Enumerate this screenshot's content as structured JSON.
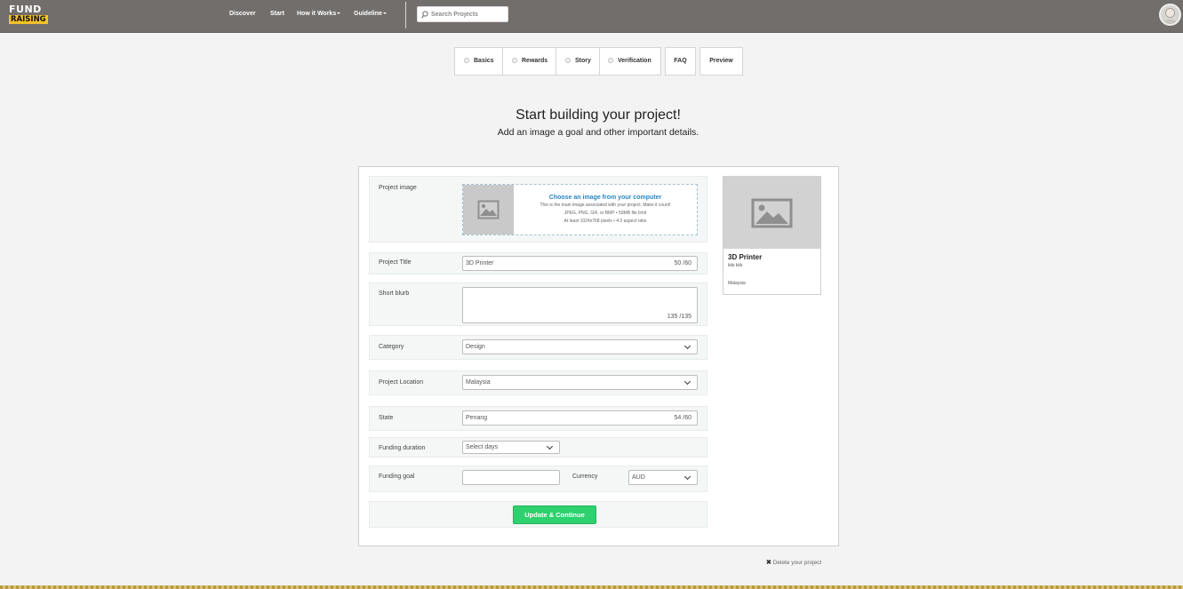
{
  "brand": {
    "line1": "FUND",
    "line2": "RAISING"
  },
  "nav": {
    "discover": "Discover",
    "start": "Start",
    "how_it_works": "How it Works",
    "guideline": "Guideline"
  },
  "search": {
    "placeholder": "Search Projects"
  },
  "tabs": {
    "basics": "Basics",
    "rewards": "Rewards",
    "story": "Story",
    "verification": "Verification",
    "faq": "FAQ",
    "preview": "Preview"
  },
  "heading": {
    "title": "Start building your project!",
    "subtitle": "Add an image a goal and other important details."
  },
  "form": {
    "project_image": {
      "label": "Project image",
      "cta": "Choose an image from your computer",
      "hint1": "This is the main image associated with your project.  Make it count!",
      "hint2": "JPEG, PNG, GIF, or BMP • 50MB file limit",
      "hint3": "At least 1024x768 pixels • 4:3 aspect ratio"
    },
    "project_title": {
      "label": "Project Title",
      "value": "3D Printer",
      "counter": "50 /60"
    },
    "short_blurb": {
      "label": "Short blurb",
      "value": "",
      "counter": "135 /135"
    },
    "category": {
      "label": "Category",
      "value": "Design"
    },
    "project_location": {
      "label": "Project Location",
      "value": "Malaysia"
    },
    "state": {
      "label": "State",
      "value": "Penang",
      "counter": "54 /60"
    },
    "funding_duration": {
      "label": "Funding duration",
      "value": "Select days"
    },
    "funding_goal": {
      "label": "Funding goal",
      "value": ""
    },
    "currency": {
      "label": "Currency",
      "value": "AUD"
    },
    "submit": "Update & Continue"
  },
  "preview_card": {
    "title": "3D Printer",
    "blurb": "kkk kkk",
    "location": "Malaysia"
  },
  "delete_label": "Delete your project",
  "colors": {
    "topbar": "#726e6b",
    "accent_green": "#2fd06e",
    "link_blue": "#2a86c4",
    "logo_yellow": "#f3c324"
  }
}
